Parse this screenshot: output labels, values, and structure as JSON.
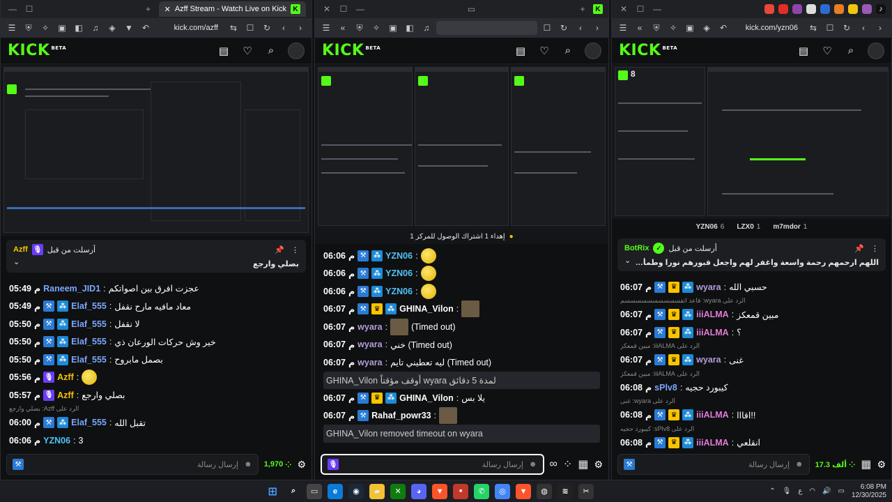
{
  "windows": {
    "left": {
      "tab_title": "Azff Stream - Watch Live on Kick",
      "url": "kick.com/azff",
      "pinned": {
        "author_label": "أرسلت من قبل",
        "author": "Azff",
        "message": "بصلي وارجع"
      },
      "messages": [
        {
          "time": "05:49",
          "user": "Raneem_JID1",
          "color": "#7aa6ff",
          "text": "عجزت افرق بين اصواتكم",
          "badges": []
        },
        {
          "time": "05:49",
          "user": "Elaf_555",
          "color": "#7aa6ff",
          "text": "معاد مافيه مارح نقفل",
          "badges": [
            "mod",
            "sub"
          ]
        },
        {
          "time": "05:50",
          "user": "Elaf_555",
          "color": "#7aa6ff",
          "text": "لا نقفل",
          "badges": [
            "mod",
            "sub"
          ]
        },
        {
          "time": "05:50",
          "user": "Elaf_555",
          "color": "#7aa6ff",
          "text": "خير وش حركات الورعان ذي",
          "badges": [
            "mod",
            "sub"
          ]
        },
        {
          "time": "05:50",
          "user": "Elaf_555",
          "color": "#7aa6ff",
          "text": "بصمل مابروح",
          "badges": [
            "mod",
            "sub"
          ]
        },
        {
          "time": "05:56",
          "user": "Azff",
          "color": "#f7c400",
          "text": "",
          "badges": [
            "og"
          ],
          "emote": true
        },
        {
          "time": "05:57",
          "user": "Azff",
          "color": "#f7c400",
          "text": "بصلي وارجع",
          "badges": [
            "og"
          ]
        },
        {
          "reply": "الرد على Azff: بصلي وارجع"
        },
        {
          "time": "06:00",
          "user": "Elaf_555",
          "color": "#7aa6ff",
          "text": "تقبل الله",
          "badges": [
            "mod",
            "sub"
          ]
        },
        {
          "time": "06:06",
          "user": "YZN06",
          "color": "#4fc3f7",
          "text": "3",
          "badges": []
        }
      ],
      "input_placeholder": "إرسال رسالة",
      "points": "1,970"
    },
    "middle": {
      "banner": "إهداء 1 اشتراك الوصول للمركز 1",
      "messages": [
        {
          "time": "06:06",
          "user": "YZN06",
          "color": "#4fc3f7",
          "badges": [
            "mod",
            "sub"
          ],
          "emote": true
        },
        {
          "time": "06:06",
          "user": "YZN06",
          "color": "#4fc3f7",
          "badges": [
            "mod",
            "sub"
          ],
          "emote": true
        },
        {
          "time": "06:06",
          "user": "YZN06",
          "color": "#4fc3f7",
          "badges": [
            "mod",
            "sub"
          ],
          "emote": true
        },
        {
          "time": "06:07",
          "user": "GHINA_Vilon",
          "color": "#ffffff",
          "badges": [
            "mod",
            "vip",
            "sub"
          ],
          "thumb": true
        },
        {
          "time": "06:07",
          "user": "wyara",
          "color": "#b39ddb",
          "text": "(Timed out)",
          "badges": [],
          "thumb": true
        },
        {
          "time": "06:07",
          "user": "wyara",
          "color": "#b39ddb",
          "text": "خني (Timed out)",
          "badges": []
        },
        {
          "time": "06:07",
          "user": "wyara",
          "color": "#b39ddb",
          "text": "ليه تعطيني تايم (Timed out)",
          "badges": []
        },
        {
          "sys": "GHINA_Vilon أوقف مؤقتاً wyara لمدة 5 دقائق"
        },
        {
          "time": "06:07",
          "user": "GHINA_Vilon",
          "color": "#ffffff",
          "text": "يلا بس",
          "badges": [
            "mod",
            "vip",
            "sub"
          ]
        },
        {
          "time": "06:07",
          "user": "Rahaf_powr33",
          "color": "#ffffff",
          "badges": [
            "mod"
          ],
          "thumb": true
        },
        {
          "sys": "GHINA_Vilon removed timeout on wyara"
        }
      ],
      "input_placeholder": "إرسال رسالة"
    },
    "right": {
      "url": "kick.com/yzn06",
      "viewers": "8",
      "leaderboard": [
        {
          "name": "YZN06",
          "count": "6"
        },
        {
          "name": "LZX0",
          "count": "1"
        },
        {
          "name": "m7mdor",
          "count": "1"
        }
      ],
      "pinned": {
        "author_label": "أرسلت من قبل",
        "author": "BotRix",
        "message": "اللهم ارحمهم رحمة واسعة واغفر لهم واجعل قبورهم نورا وطمأنينة واجمعنا بهم في جناتك بلا حساب ولا عذاب"
      },
      "messages": [
        {
          "time": "06:07",
          "user": "wyara",
          "color": "#b39ddb",
          "text": "حسبي الله",
          "badges": [
            "mod",
            "vip",
            "sub"
          ]
        },
        {
          "reply": "الرد على wyara: قاعد اتفسسسسسسسسسسم"
        },
        {
          "time": "06:07",
          "user": "iiiALMA",
          "color": "#e07bd8",
          "text": "مبين قمعكز",
          "badges": [
            "mod",
            "vip",
            "sub"
          ]
        },
        {
          "time": "06:07",
          "user": "iiiALMA",
          "color": "#e07bd8",
          "text": "؟",
          "badges": [
            "mod",
            "vip",
            "sub"
          ]
        },
        {
          "reply": "الرد على iiiALMA: مبين قمعكز"
        },
        {
          "time": "06:07",
          "user": "wyara",
          "color": "#b39ddb",
          "text": "غنى",
          "badges": [
            "mod",
            "vip",
            "sub"
          ]
        },
        {
          "reply": "الرد على iiiALMA: مبين قمعكز"
        },
        {
          "time": "06:08",
          "user": "sPlv8",
          "color": "#7aa6ff",
          "text": "كيبورد حجيه",
          "badges": []
        },
        {
          "reply": "الرد على wyara: غنى"
        },
        {
          "time": "06:08",
          "user": "iiiALMA",
          "color": "#e07bd8",
          "text": "اقااا!!",
          "badges": [
            "mod",
            "vip",
            "sub"
          ]
        },
        {
          "reply": "الرد على sPlv8: كيبورد حجيه"
        },
        {
          "time": "06:08",
          "user": "iiiALMA",
          "color": "#e07bd8",
          "text": "انقلعي",
          "badges": [
            "mod",
            "vip",
            "sub"
          ]
        }
      ],
      "input_placeholder": "إرسال رسالة",
      "points": "17.3 ألف"
    }
  },
  "ampm": "م",
  "taskbar": {
    "time": "6:08 PM",
    "date": "12/30/2025",
    "lang": "ع"
  },
  "colors": {
    "kick_green": "#53fc18"
  }
}
